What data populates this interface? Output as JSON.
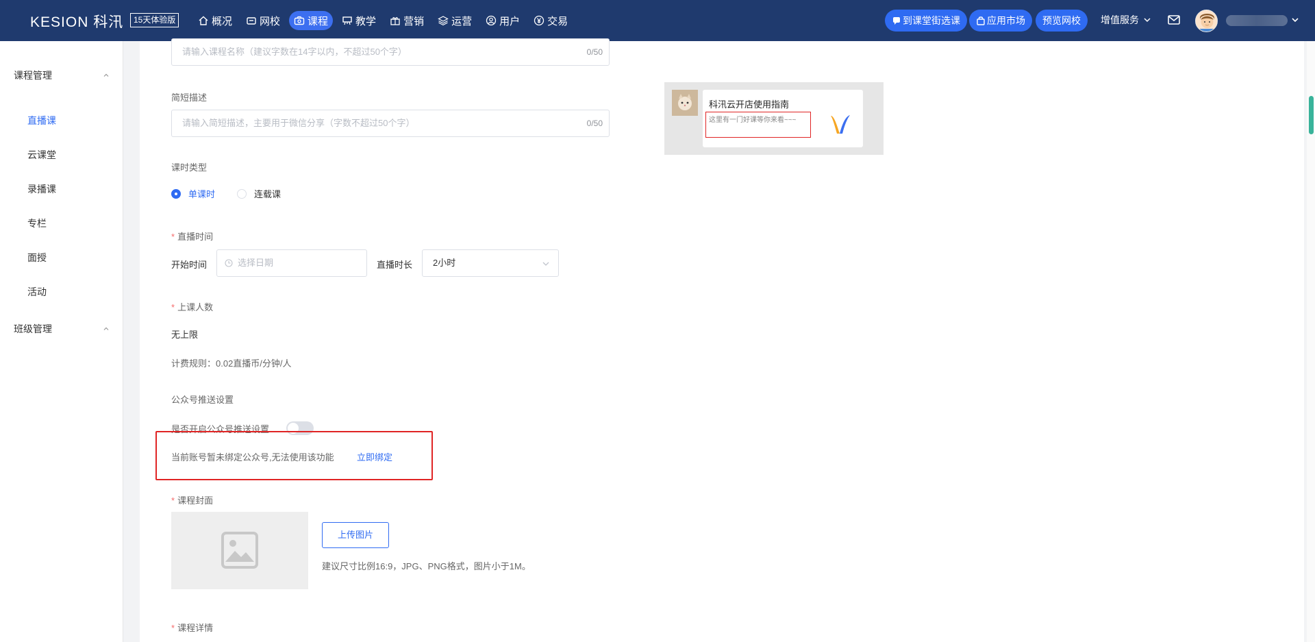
{
  "brand": {
    "logo": "KESION 科汛",
    "trial_badge": "15天体验版"
  },
  "nav": [
    {
      "label": "概况",
      "icon": "home-icon"
    },
    {
      "label": "网校",
      "icon": "school-icon"
    },
    {
      "label": "课程",
      "icon": "course-icon",
      "active": true
    },
    {
      "label": "教学",
      "icon": "teaching-icon"
    },
    {
      "label": "营销",
      "icon": "gift-icon"
    },
    {
      "label": "运营",
      "icon": "layers-icon"
    },
    {
      "label": "用户",
      "icon": "user-icon"
    },
    {
      "label": "交易",
      "icon": "yen-icon"
    }
  ],
  "header_actions": {
    "course_street": "到课堂街选课",
    "app_market": "应用市场",
    "preview_school": "预览网校",
    "value_added": "增值服务"
  },
  "sidebar": {
    "group1": "课程管理",
    "items": [
      "直播课",
      "云课堂",
      "录播课",
      "专栏",
      "面授",
      "活动"
    ],
    "active_index": 0,
    "group2": "班级管理"
  },
  "form": {
    "name_placeholder": "请输入课程名称（建议字数在14字以内，不超过50个字）",
    "name_count": "0/50",
    "desc_label": "简短描述",
    "desc_placeholder": "请输入简短描述，主要用于微信分享（字数不超过50个字）",
    "desc_count": "0/50",
    "lesson_type_label": "课时类型",
    "lesson_type_single": "单课时",
    "lesson_type_series": "连载课",
    "live_time_label": "直播时间",
    "start_time_label": "开始时间",
    "date_placeholder": "选择日期",
    "duration_label": "直播时长",
    "duration_value": "2小时",
    "capacity_label": "上课人数",
    "capacity_value": "无上限",
    "billing_rule": "计费规则：0.02直播币/分钟/人",
    "wechat_push_title": "公众号推送设置",
    "wechat_push_toggle_label": "是否开启公众号推送设置",
    "wechat_unbound_msg": "当前账号暂未绑定公众号,无法使用该功能",
    "wechat_bind_link": "立即绑定",
    "cover_label": "课程封面",
    "upload_button": "上传图片",
    "cover_hint": "建议尺寸比例16:9，JPG、PNG格式，图片小于1M。",
    "detail_label": "课程详情"
  },
  "share_preview": {
    "title": "科汛云开店使用指南",
    "desc": "这里有一门好课等你来看~~~"
  },
  "colors": {
    "topbar": "#1f3a6e",
    "accent": "#2f6bf2",
    "highlight": "#e02424"
  }
}
